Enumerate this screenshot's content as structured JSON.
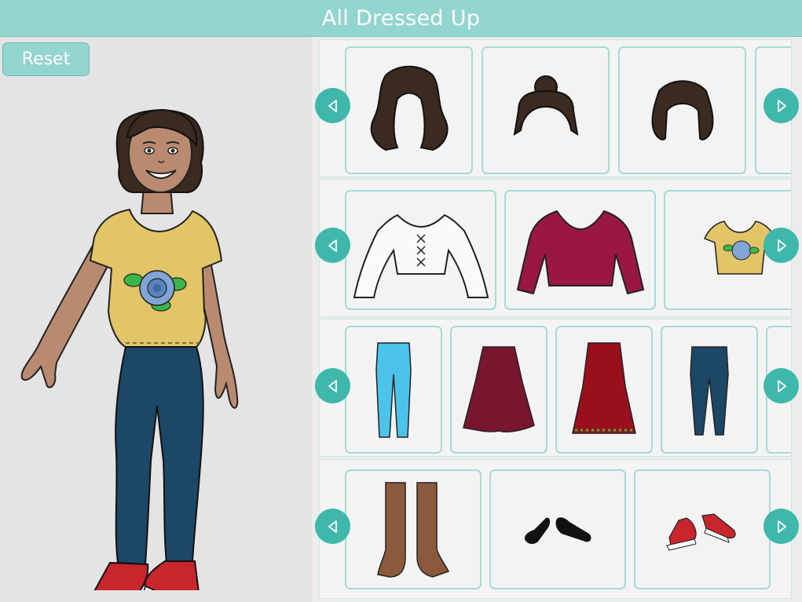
{
  "header": {
    "title": "All Dressed Up"
  },
  "controls": {
    "reset_label": "Reset"
  },
  "colors": {
    "header_bg": "#93d5cf",
    "arrow_bg": "#3fb8ab",
    "card_border": "#a6dbd6",
    "hair": "#3b2a20",
    "skin": "#b98a70",
    "shirt": "#e1c566",
    "jeans": "#1d4766",
    "sneakers": "#c9252c"
  },
  "categories": [
    {
      "name": "hair",
      "items": [
        "curly-long-hair",
        "bun-hair",
        "wavy-bob-hair",
        "partial-hair"
      ]
    },
    {
      "name": "tops",
      "items": [
        "white-peasant-blouse",
        "burgundy-sweetheart-top",
        "yellow-rose-tee"
      ]
    },
    {
      "name": "bottoms",
      "items": [
        "light-blue-jeans",
        "maroon-flared-skirt",
        "red-beaded-skirt",
        "navy-jeans",
        "partial-bottom"
      ]
    },
    {
      "name": "shoes",
      "items": [
        "brown-tall-boots",
        "black-flats",
        "red-sneakers"
      ]
    }
  ]
}
